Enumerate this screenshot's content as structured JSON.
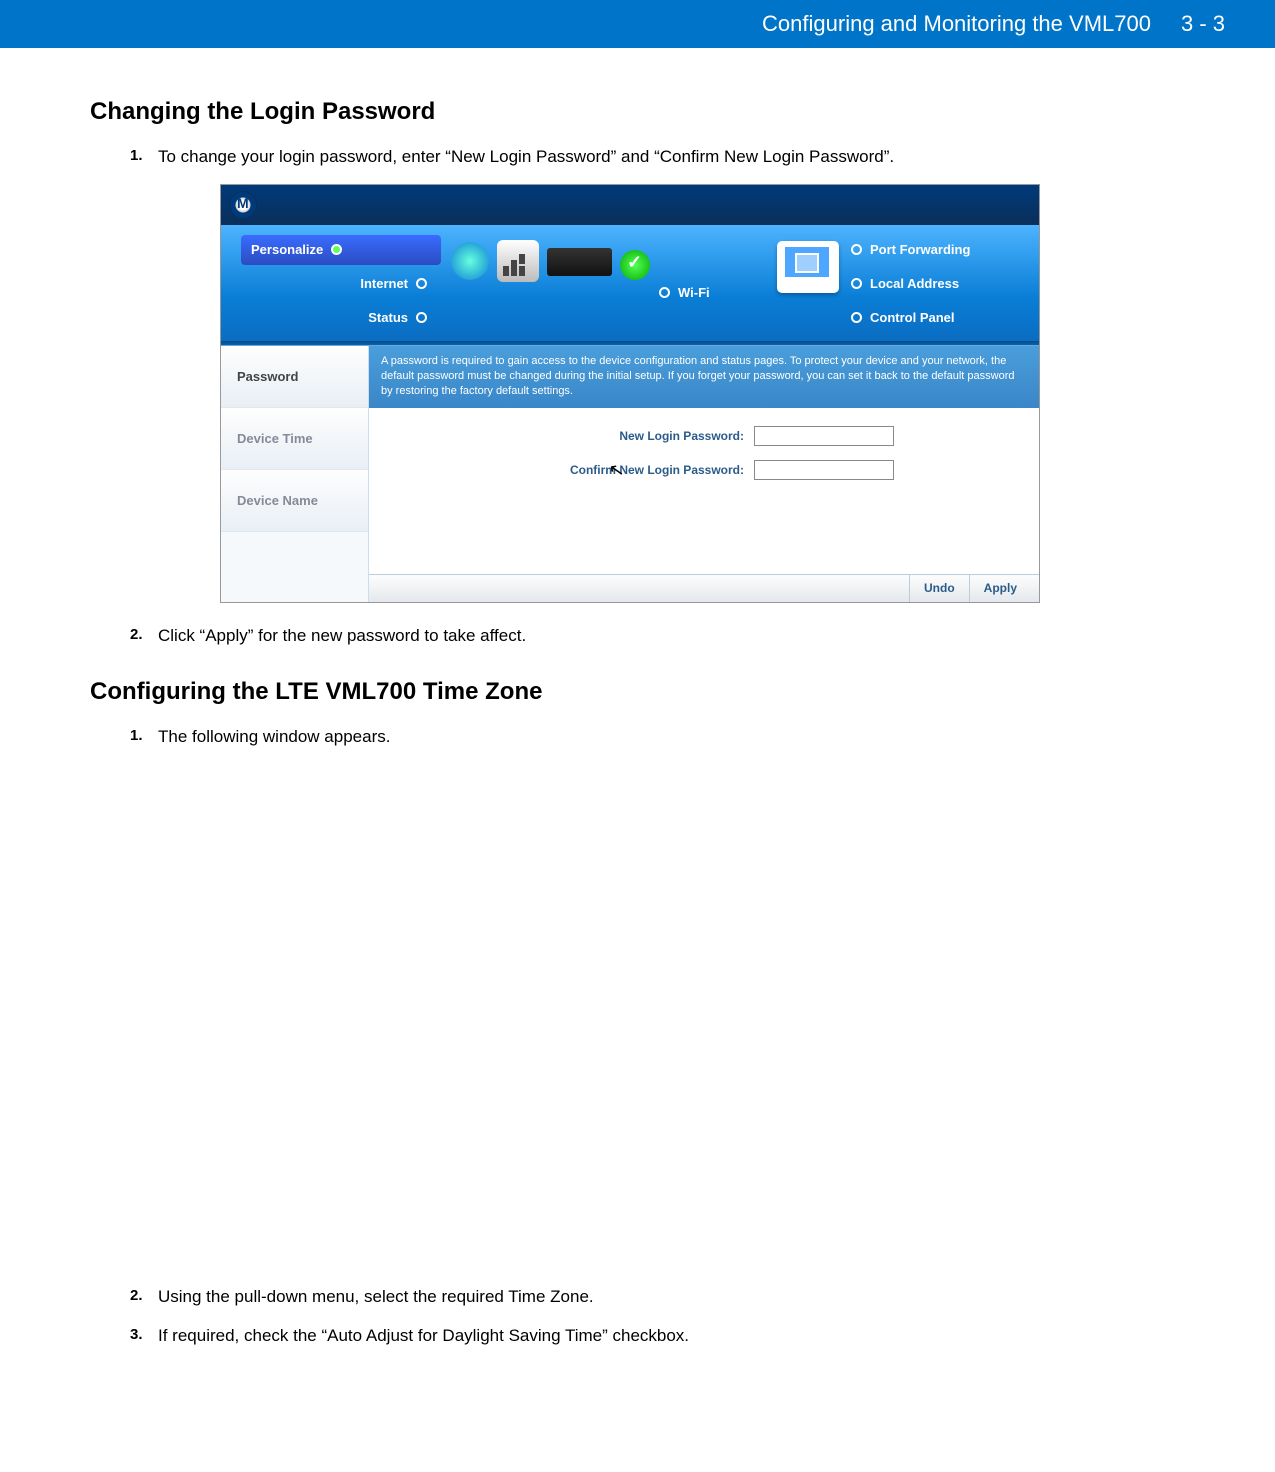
{
  "header": {
    "title": "Configuring and Monitoring the VML700",
    "page": "3 - 3"
  },
  "section1": {
    "heading": "Changing the Login Password",
    "step1": {
      "num": "1.",
      "text": "To change your login password, enter “New Login Password” and “Confirm New Login Password”."
    },
    "step2": {
      "num": "2.",
      "text": "Click “Apply” for the new password to take affect."
    }
  },
  "section2": {
    "heading": "Configuring the LTE VML700 Time Zone",
    "step1": {
      "num": "1.",
      "text": "The following window appears."
    },
    "step2": {
      "num": "2.",
      "text": "Using the pull-down menu, select the required Time Zone."
    },
    "step3": {
      "num": "3.",
      "text": "If required, check the “Auto Adjust for Daylight Saving Time” checkbox."
    }
  },
  "router_ui": {
    "nav": {
      "personalize": "Personalize",
      "internet": "Internet",
      "status": "Status",
      "wifi": "Wi-Fi",
      "port_forwarding": "Port Forwarding",
      "local_address": "Local Address",
      "control_panel": "Control Panel"
    },
    "help_text": "A password is required to gain access to the device configuration and status pages. To protect your device and your network, the default password must be changed during the initial setup. If you forget your password, you can set it back to the default password by restoring the factory default settings.",
    "side_tabs": {
      "password": "Password",
      "device_time": "Device Time",
      "device_name": "Device Name"
    },
    "form": {
      "new_password_label": "New Login Password:",
      "confirm_password_label": "Confirm New Login Password:"
    },
    "buttons": {
      "undo": "Undo",
      "apply": "Apply"
    }
  }
}
